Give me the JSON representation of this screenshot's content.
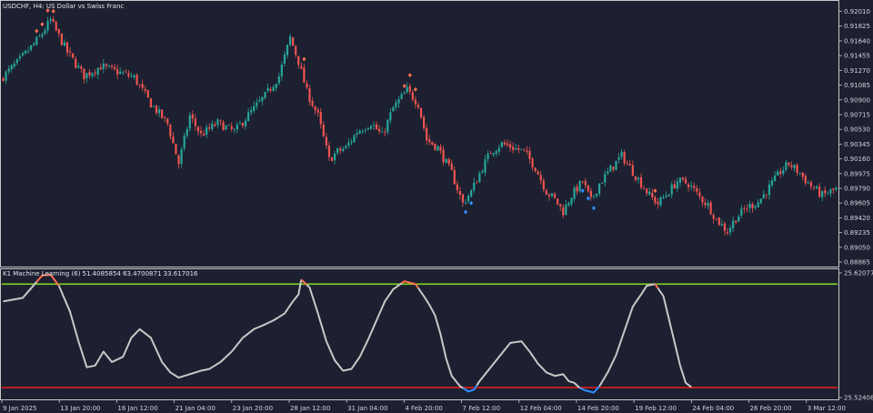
{
  "window": {
    "main_title": "USDCHF, H4:  US Dollar vs Swiss Franc",
    "indicator_title": "K1 Machine Learning (6) 51.4085854 63.4700871 33.617016"
  },
  "colors": {
    "background": "#1c2030",
    "bull": "#26a69a",
    "bear": "#ef5350",
    "signal_sell": "#ff6e54",
    "signal_buy": "#2f8fff",
    "oscillator": "#c8c8c8",
    "upper_level": "#7fd320",
    "lower_level": "#e01e1e",
    "frame": "#c8c8c8"
  },
  "chart_data": [
    {
      "type": "candlestick",
      "name": "price",
      "x_tick_labels": [
        "9 Jan 2025",
        "13 Jan 20:00",
        "16 Jan 12:00",
        "21 Jan 04:00",
        "23 Jan 20:00",
        "28 Jan 12:00",
        "31 Jan 04:00",
        "4 Feb 20:00",
        "7 Feb 12:00",
        "12 Feb 04:00",
        "14 Feb 20:00",
        "19 Feb 12:00",
        "24 Feb 04:00",
        "26 Feb 20:00",
        "3 Mar 12:00"
      ],
      "y_tick_labels": [
        "0.92010",
        "0.91825",
        "0.91640",
        "0.91455",
        "0.91270",
        "0.91085",
        "0.90900",
        "0.90715",
        "0.90530",
        "0.90345",
        "0.90160",
        "0.89975",
        "0.89790",
        "0.89605",
        "0.89420",
        "0.89235",
        "0.89050",
        "0.88865"
      ],
      "ylim": [
        0.8882,
        0.9213
      ],
      "close_path": [
        [
          0,
          0.9116
        ],
        [
          7,
          0.914
        ],
        [
          14,
          0.9168
        ],
        [
          18,
          0.919
        ],
        [
          24,
          0.915
        ],
        [
          30,
          0.912
        ],
        [
          36,
          0.9132
        ],
        [
          42,
          0.9125
        ],
        [
          48,
          0.9118
        ],
        [
          54,
          0.9085
        ],
        [
          60,
          0.906
        ],
        [
          64,
          0.901
        ],
        [
          68,
          0.907
        ],
        [
          72,
          0.9046
        ],
        [
          78,
          0.9061
        ],
        [
          84,
          0.905
        ],
        [
          90,
          0.9075
        ],
        [
          95,
          0.9095
        ],
        [
          100,
          0.912
        ],
        [
          104,
          0.9168
        ],
        [
          107,
          0.9138
        ],
        [
          110,
          0.91
        ],
        [
          114,
          0.907
        ],
        [
          118,
          0.9015
        ],
        [
          121,
          0.9025
        ],
        [
          124,
          0.903
        ],
        [
          128,
          0.905
        ],
        [
          133,
          0.9061
        ],
        [
          137,
          0.9045
        ],
        [
          141,
          0.908
        ],
        [
          146,
          0.9102
        ],
        [
          150,
          0.9085
        ],
        [
          153,
          0.904
        ],
        [
          157,
          0.903
        ],
        [
          162,
          0.8998
        ],
        [
          166,
          0.896
        ],
        [
          169,
          0.8975
        ],
        [
          173,
          0.9005
        ],
        [
          176,
          0.9025
        ],
        [
          180,
          0.9035
        ],
        [
          184,
          0.903
        ],
        [
          188,
          0.9025
        ],
        [
          192,
          0.9005
        ],
        [
          196,
          0.8975
        ],
        [
          199,
          0.8965
        ],
        [
          202,
          0.895
        ],
        [
          205,
          0.897
        ],
        [
          209,
          0.8988
        ],
        [
          212,
          0.8963
        ],
        [
          215,
          0.8985
        ],
        [
          219,
          0.9003
        ],
        [
          223,
          0.902
        ],
        [
          226,
          0.9005
        ],
        [
          229,
          0.899
        ],
        [
          233,
          0.897
        ],
        [
          236,
          0.896
        ],
        [
          240,
          0.8975
        ],
        [
          243,
          0.8988
        ],
        [
          247,
          0.8985
        ],
        [
          251,
          0.8968
        ],
        [
          254,
          0.8958
        ],
        [
          257,
          0.894
        ],
        [
          261,
          0.8925
        ],
        [
          264,
          0.8942
        ],
        [
          268,
          0.8955
        ],
        [
          272,
          0.8962
        ],
        [
          276,
          0.898
        ],
        [
          280,
          0.9
        ],
        [
          283,
          0.901
        ],
        [
          287,
          0.8998
        ],
        [
          290,
          0.8985
        ],
        [
          295,
          0.897
        ],
        [
          300,
          0.8978
        ]
      ]
    },
    {
      "type": "line",
      "name": "K1 Machine Learning (6)",
      "y_tick_labels": [
        "25.620777",
        "25.524088"
      ],
      "levels": [
        63.47,
        33.62
      ],
      "overbought_threshold": 63.47,
      "oversold_threshold": 33.62,
      "ylim": [
        30.5,
        67.5
      ],
      "values_path": [
        [
          0,
          58.5
        ],
        [
          7,
          59.5
        ],
        [
          11,
          63.2
        ],
        [
          14,
          66.0
        ],
        [
          17,
          66.2
        ],
        [
          20,
          63.0
        ],
        [
          24,
          55.5
        ],
        [
          27,
          47.0
        ],
        [
          30,
          39.5
        ],
        [
          33,
          40.0
        ],
        [
          36,
          44.0
        ],
        [
          39,
          41.0
        ],
        [
          43,
          42.5
        ],
        [
          46,
          48.0
        ],
        [
          49,
          50.5
        ],
        [
          53,
          48.0
        ],
        [
          57,
          41.0
        ],
        [
          60,
          38.0
        ],
        [
          63,
          36.5
        ],
        [
          67,
          37.5
        ],
        [
          71,
          38.5
        ],
        [
          74,
          39.0
        ],
        [
          78,
          41.0
        ],
        [
          82,
          44.0
        ],
        [
          86,
          48.0
        ],
        [
          90,
          50.5
        ],
        [
          93,
          51.5
        ],
        [
          97,
          53.0
        ],
        [
          101,
          55.0
        ],
        [
          104,
          58.5
        ],
        [
          106,
          60.5
        ],
        [
          107,
          64.8
        ],
        [
          110,
          62.5
        ],
        [
          113,
          55.0
        ],
        [
          116,
          47.0
        ],
        [
          119,
          41.5
        ],
        [
          122,
          38.5
        ],
        [
          125,
          39.0
        ],
        [
          128,
          42.5
        ],
        [
          131,
          47.5
        ],
        [
          134,
          53.0
        ],
        [
          137,
          58.5
        ],
        [
          140,
          62.0
        ],
        [
          144,
          64.3
        ],
        [
          148,
          63.5
        ],
        [
          151,
          60.0
        ],
        [
          153,
          57.5
        ],
        [
          155,
          54.5
        ],
        [
          157,
          49.0
        ],
        [
          159,
          42.0
        ],
        [
          161,
          37.0
        ],
        [
          164,
          34.0
        ],
        [
          167,
          32.5
        ],
        [
          169,
          33.0
        ],
        [
          171,
          35.5
        ],
        [
          174,
          38.5
        ],
        [
          178,
          42.5
        ],
        [
          182,
          46.5
        ],
        [
          186,
          47.0
        ],
        [
          189,
          44.0
        ],
        [
          192,
          40.5
        ],
        [
          195,
          38.0
        ],
        [
          198,
          37.0
        ],
        [
          201,
          37.5
        ],
        [
          203,
          35.5
        ],
        [
          205,
          35.0
        ],
        [
          207,
          33.5
        ],
        [
          209,
          32.8
        ],
        [
          212,
          32.2
        ],
        [
          214,
          34.0
        ],
        [
          217,
          38.0
        ],
        [
          220,
          43.0
        ],
        [
          223,
          50.0
        ],
        [
          226,
          57.0
        ],
        [
          229,
          60.5
        ],
        [
          231,
          63.0
        ],
        [
          234,
          63.5
        ],
        [
          237,
          60.0
        ],
        [
          240,
          50.0
        ],
        [
          243,
          40.0
        ],
        [
          245,
          35.0
        ],
        [
          247,
          33.8
        ]
      ]
    }
  ]
}
